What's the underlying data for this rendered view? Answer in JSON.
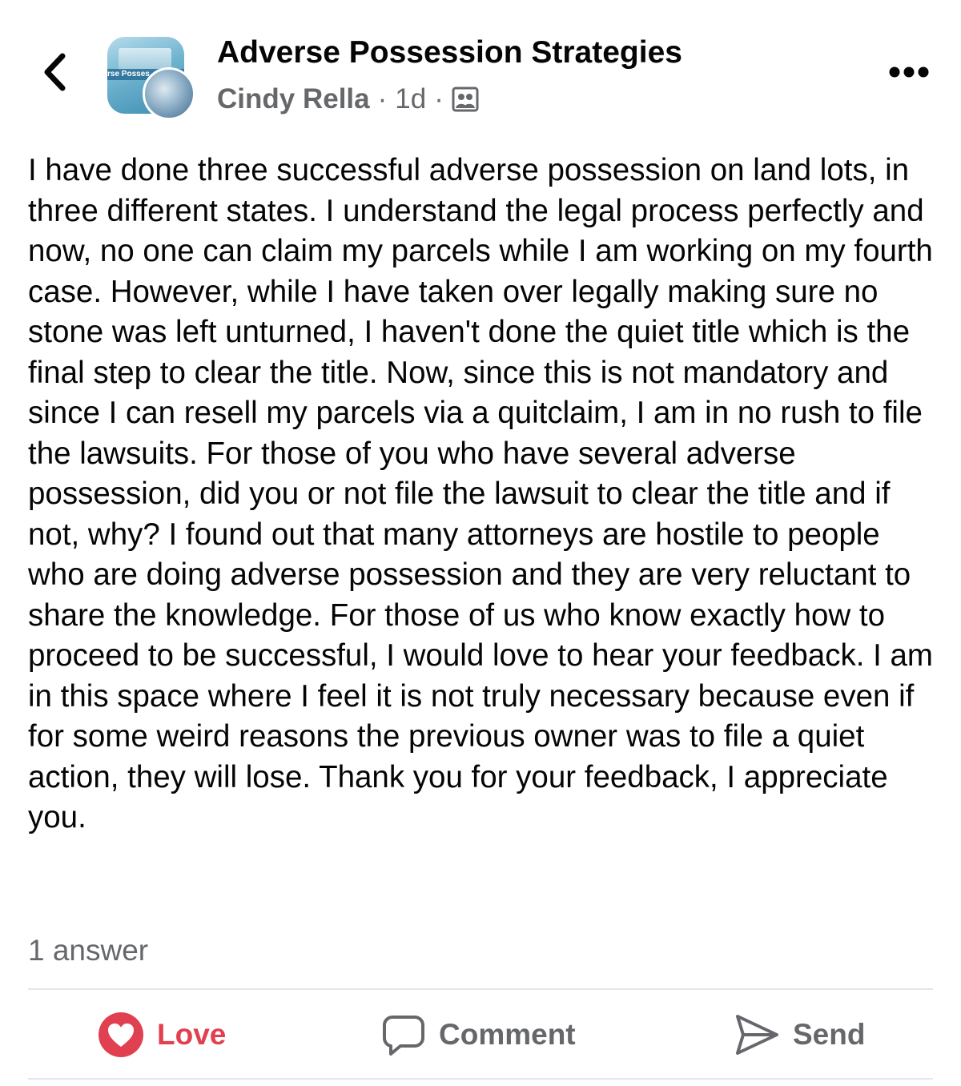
{
  "header": {
    "back_icon": "chevron-left-icon",
    "group_name": "Adverse Possession Strategies",
    "group_avatar_text": "rse Posses",
    "author": "Cindy Rella",
    "separator": "·",
    "time": "1d",
    "audience_icon": "group-members-icon",
    "more_icon": "ellipsis-icon"
  },
  "post": {
    "body": "I have done three successful adverse possession on land lots, in three different states. I understand the legal process perfectly and now, no one can claim my parcels while I am working on my fourth case. However, while I have taken over legally making sure no stone was left unturned, I haven't done the quiet title which is the final step to clear the title. Now, since this is not mandatory and since I can resell my parcels via a quitclaim, I am in no rush to file the lawsuits. For those of you who have several adverse possession, did you or not file the lawsuit to clear the title and if not, why? I found out that many attorneys are hostile to people who are doing adverse possession and they are very reluctant to share the knowledge. For those of us who know exactly how to proceed to be successful, I would love to hear your feedback. I am in this space where I feel it is not truly necessary because even if for some weird reasons the previous owner was to file a quiet action, they will lose. Thank you for your feedback, I appreciate you.",
    "answers": "1 answer"
  },
  "actions": {
    "love_label": "Love",
    "comment_label": "Comment",
    "send_label": "Send"
  },
  "colors": {
    "love": "#e0404f",
    "secondary_text": "#65676b",
    "primary_text": "#050505",
    "divider": "#e4e6eb"
  }
}
